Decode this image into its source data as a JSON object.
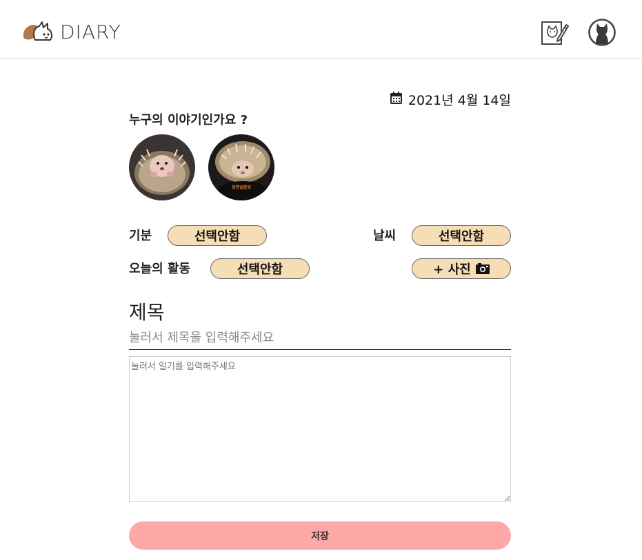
{
  "header": {
    "logo_text": "DIARY",
    "logo_icon": "dog-cat-logo-icon",
    "write_icon": "diary-write-icon",
    "profile_icon": "cat-profile-icon"
  },
  "date": {
    "icon": "calendar-icon",
    "text": "2021년 4월 14일"
  },
  "pets": {
    "label": "누구의 이야기인가요 ?",
    "items": [
      {
        "name": "hedgehog-photo-1",
        "caption": ""
      },
      {
        "name": "hedgehog-photo-2",
        "caption": "장면실종쌋"
      }
    ]
  },
  "fields": {
    "mood": {
      "label": "기분",
      "value": "선택안함"
    },
    "weather": {
      "label": "날씨",
      "value": "선택안함"
    },
    "activity": {
      "label": "오늘의 활동",
      "value": "선택안함"
    },
    "photo_button": {
      "label": "+ 사진",
      "icon": "camera-icon"
    }
  },
  "title": {
    "heading": "제목",
    "placeholder": "눌러서 제목을 입력해주세요",
    "value": ""
  },
  "body": {
    "placeholder": "눌러서 일기를 입력해주세요",
    "value": ""
  },
  "save_button": {
    "label": "저장"
  },
  "colors": {
    "pill_bg": "#f5deb6",
    "save_bg": "#fca9a7",
    "header_border": "#d6d6d6"
  }
}
